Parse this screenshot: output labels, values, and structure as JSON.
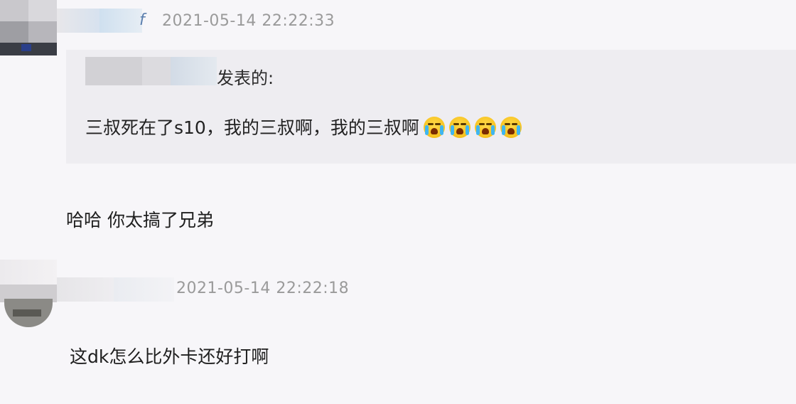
{
  "comments": [
    {
      "timestamp": "2021-05-14 22:22:33",
      "username_tail": "f",
      "quote": {
        "suffix": "发表的:",
        "text": "三叔死在了s10，我的三叔啊，我的三叔啊",
        "emojis": [
          "crying-face-icon",
          "crying-face-icon",
          "crying-face-icon",
          "crying-face-icon"
        ]
      },
      "reply": "哈哈 你太搞了兄弟"
    },
    {
      "timestamp": "2021-05-14 22:22:18",
      "reply": "这dk怎么比外卡还好打啊"
    }
  ],
  "colors": {
    "background": "#f7f6f9",
    "quote_background": "#eeedf1",
    "timestamp": "#9a9a9a",
    "emoji_face": "#f7c21e",
    "emoji_tear": "#3fb6f0"
  }
}
